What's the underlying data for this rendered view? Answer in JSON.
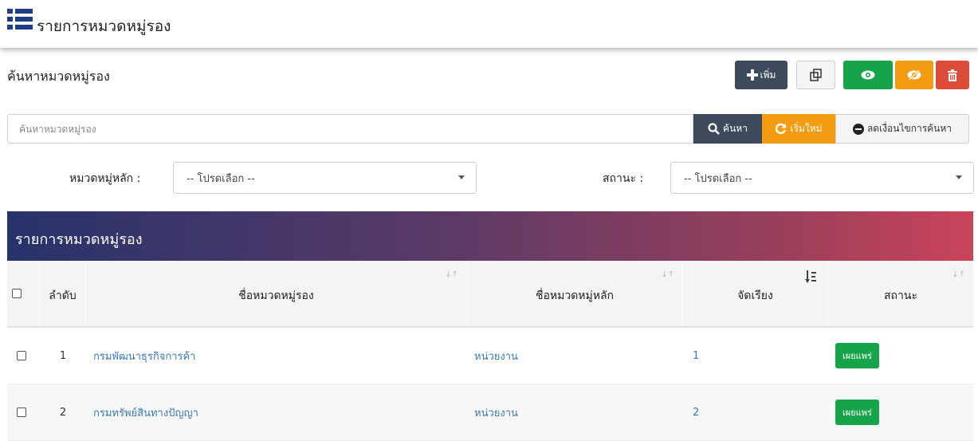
{
  "header": {
    "title": "รายการหมวดหมู่รอง"
  },
  "search_panel": {
    "title": "ค้นหาหมวดหมู่รอง",
    "add_label": "เพิ่ม",
    "search_placeholder": "ค้นหาหมวดหมู่รอง",
    "search_label": "ค้นหา",
    "reset_label": "เริ่มใหม่",
    "clear_label": "ลดเงื่อนไขการค้นหา"
  },
  "filters": {
    "main_category_label": "หมวดหมู่หลัก :",
    "main_category_value": "-- โปรดเลือก --",
    "status_label": "สถานะ :",
    "status_value": "-- โปรดเลือก --"
  },
  "table": {
    "caption": "รายการหมวดหมู่รอง",
    "columns": [
      "ลำดับ",
      "ชื่อหมวดหมู่รอง",
      "ชื่อหมวดหมู่หลัก",
      "จัดเรียง",
      "สถานะ"
    ],
    "rows": [
      {
        "no": "1",
        "name": "กรมพัฒนาธุรกิจการค้า",
        "parent": "หน่วยงาน",
        "order": "1",
        "status": "เผยแพร่"
      },
      {
        "no": "2",
        "name": "กรมทรัพย์สินทางปัญญา",
        "parent": "หน่วยงาน",
        "order": "2",
        "status": "เผยแพร่"
      }
    ]
  },
  "colors": {
    "primary": "#3d4a5c",
    "success": "#17a34a",
    "warning": "#f39c12",
    "danger": "#dd4b39",
    "link": "#3b79b8"
  },
  "icons": [
    "list-icon",
    "plus-icon",
    "copy-icon",
    "eye-icon",
    "eye-slash-icon",
    "trash-icon",
    "search-icon",
    "refresh-icon",
    "minus-circle-icon",
    "sort-icon"
  ]
}
